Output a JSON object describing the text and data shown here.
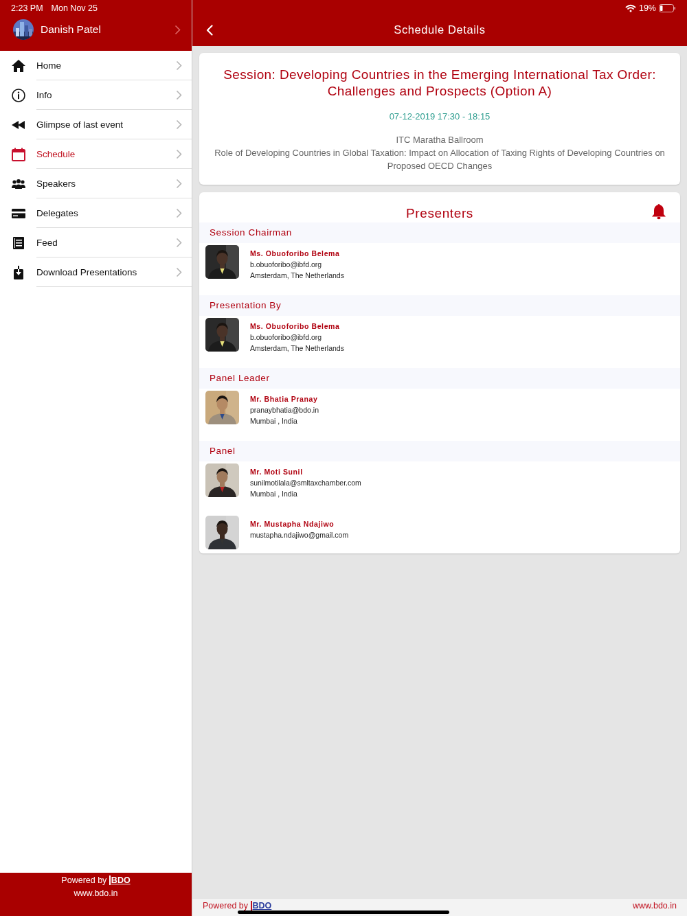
{
  "status_bar": {
    "time": "2:23 PM",
    "date": "Mon Nov 25",
    "battery": "19%"
  },
  "profile": {
    "name": "Danish Patel"
  },
  "menu": [
    {
      "label": "Home",
      "selected": false
    },
    {
      "label": "Info",
      "selected": false
    },
    {
      "label": "Glimpse of last event",
      "selected": false
    },
    {
      "label": "Schedule",
      "selected": true
    },
    {
      "label": "Speakers",
      "selected": false
    },
    {
      "label": "Delegates",
      "selected": false
    },
    {
      "label": "Feed",
      "selected": false
    },
    {
      "label": "Download Presentations",
      "selected": false
    }
  ],
  "sidebar_footer": {
    "powered_by": "Powered by",
    "brand": "BDO",
    "link": "www.bdo.in"
  },
  "header": {
    "title": "Schedule Details"
  },
  "session": {
    "title": "Session: Developing Countries in the Emerging International Tax Order: Challenges and Prospects (Option A)",
    "datetime": "07-12-2019 17:30 - 18:15",
    "venue": "ITC Maratha Ballroom",
    "description": "Role of Developing Countries in Global Taxation: Impact on Allocation of Taxing Rights of Developing Countries on Proposed OECD Changes"
  },
  "presenters": {
    "title": "Presenters",
    "groups": [
      {
        "role": "Session Chairman",
        "people": [
          {
            "name": "Ms. Obuoforibo Belema",
            "email": "b.obuoforibo@ibfd.org",
            "location": "Amsterdam, The Netherlands"
          }
        ]
      },
      {
        "role": "Presentation By",
        "people": [
          {
            "name": "Ms. Obuoforibo Belema",
            "email": "b.obuoforibo@ibfd.org",
            "location": "Amsterdam, The Netherlands"
          }
        ]
      },
      {
        "role": "Panel Leader",
        "people": [
          {
            "name": "Mr. Bhatia Pranay",
            "email": "pranaybhatia@bdo.in",
            "location": "Mumbai , India"
          }
        ]
      },
      {
        "role": "Panel",
        "people": [
          {
            "name": "Mr. Moti Sunil",
            "email": "sunilmotilala@smltaxchamber.com",
            "location": "Mumbai , India"
          },
          {
            "name": "Mr. Mustapha Ndajiwo",
            "email": "mustapha.ndajiwo@gmail.com"
          }
        ]
      }
    ]
  },
  "footer": {
    "powered_by": "Powered by",
    "brand": "BDO",
    "link": "www.bdo.in"
  }
}
